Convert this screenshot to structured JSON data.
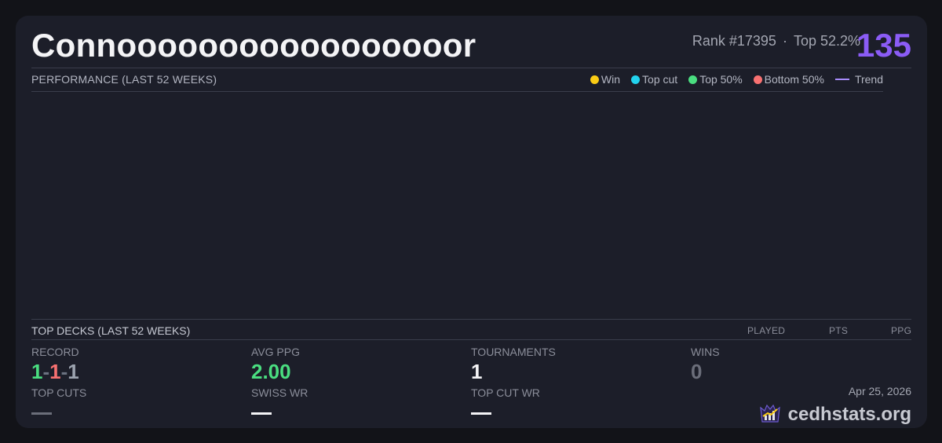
{
  "header": {
    "player_name": "Connooooooooooooooooor",
    "rank": "Rank #17395",
    "separator": "·",
    "top_percent": "Top 52.2%",
    "score": "135"
  },
  "performance": {
    "title": "PERFORMANCE (LAST 52 WEEKS)",
    "legend": [
      {
        "label": "Win",
        "color": "#facc15",
        "kind": "dot"
      },
      {
        "label": "Top cut",
        "color": "#22d3ee",
        "kind": "dot"
      },
      {
        "label": "Top 50%",
        "color": "#4ade80",
        "kind": "dot"
      },
      {
        "label": "Bottom 50%",
        "color": "#f87171",
        "kind": "dot"
      },
      {
        "label": "Trend",
        "color": "#a78bfa",
        "kind": "line"
      }
    ]
  },
  "top_decks": {
    "title": "TOP DECKS (LAST 52 WEEKS)",
    "columns": [
      "PLAYED",
      "PTS",
      "PPG"
    ]
  },
  "stats": {
    "record_label": "RECORD",
    "record_wins": "1",
    "record_losses": "1",
    "record_draws": "1",
    "record_sep": "-",
    "avg_ppg_label": "AVG PPG",
    "avg_ppg_value": "2.00",
    "tournaments_label": "TOURNAMENTS",
    "tournaments_value": "1",
    "wins_label": "WINS",
    "wins_value": "0",
    "top_cuts_label": "TOP CUTS",
    "swiss_wr_label": "SWISS WR",
    "top_cut_wr_label": "TOP CUT WR"
  },
  "footer": {
    "date": "Apr 25, 2026",
    "brand": "cedhstats.org"
  },
  "colors": {
    "accent": "#8b5cf6",
    "win": "#4ade80",
    "loss": "#f87171",
    "draw": "#9ca3af"
  }
}
